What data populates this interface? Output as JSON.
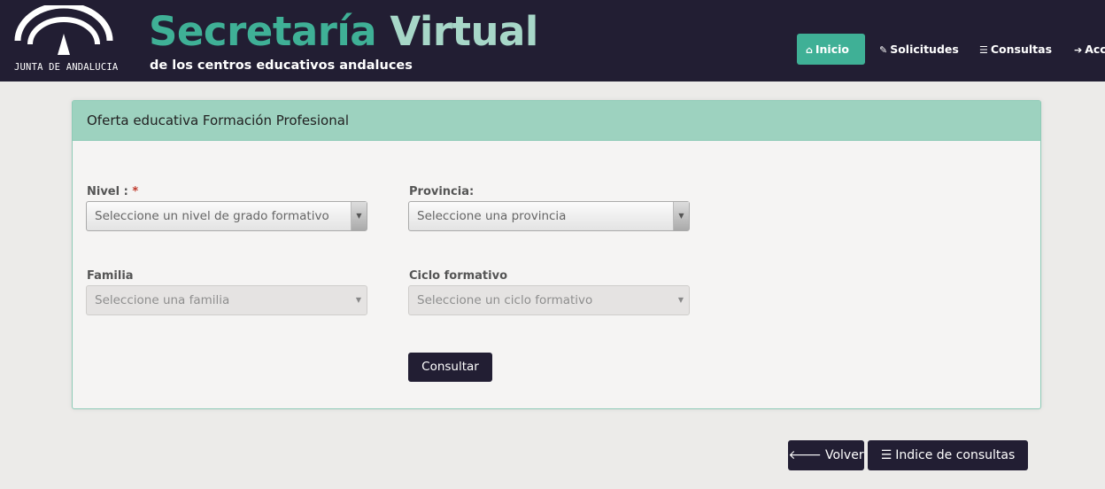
{
  "header": {
    "logo_text": "JUNTA DE ANDALUCIA",
    "title_part1": "Secretaría",
    "title_part2": "Virtual",
    "subtitle": "de los centros educativos andaluces",
    "nav": [
      {
        "label": "Inicio",
        "icon": "home-icon"
      },
      {
        "label": "Solicitudes",
        "icon": "pencil-icon"
      },
      {
        "label": "Consultas",
        "icon": "list-icon"
      },
      {
        "label": "Acc",
        "icon": "sign-in-icon"
      }
    ]
  },
  "panel": {
    "title": "Oferta educativa Formación Profesional",
    "nivel": {
      "label": "Nivel :",
      "required_mark": "*",
      "value": "Seleccione un nivel de grado formativo"
    },
    "provincia": {
      "label": "Provincia:",
      "value": "Seleccione una provincia"
    },
    "familia": {
      "label": "Familia",
      "value": "Seleccione una familia"
    },
    "ciclo": {
      "label": "Ciclo formativo",
      "value": "Seleccione un ciclo formativo"
    },
    "consultar_label": "Consultar"
  },
  "footer": {
    "volver_label": "Volver",
    "indice_label": "Indice de consultas"
  },
  "colors": {
    "header_bg": "#221e33",
    "accent": "#3fb096",
    "accent_light": "#a7d7c8",
    "panel_head": "#9dd2bf"
  }
}
